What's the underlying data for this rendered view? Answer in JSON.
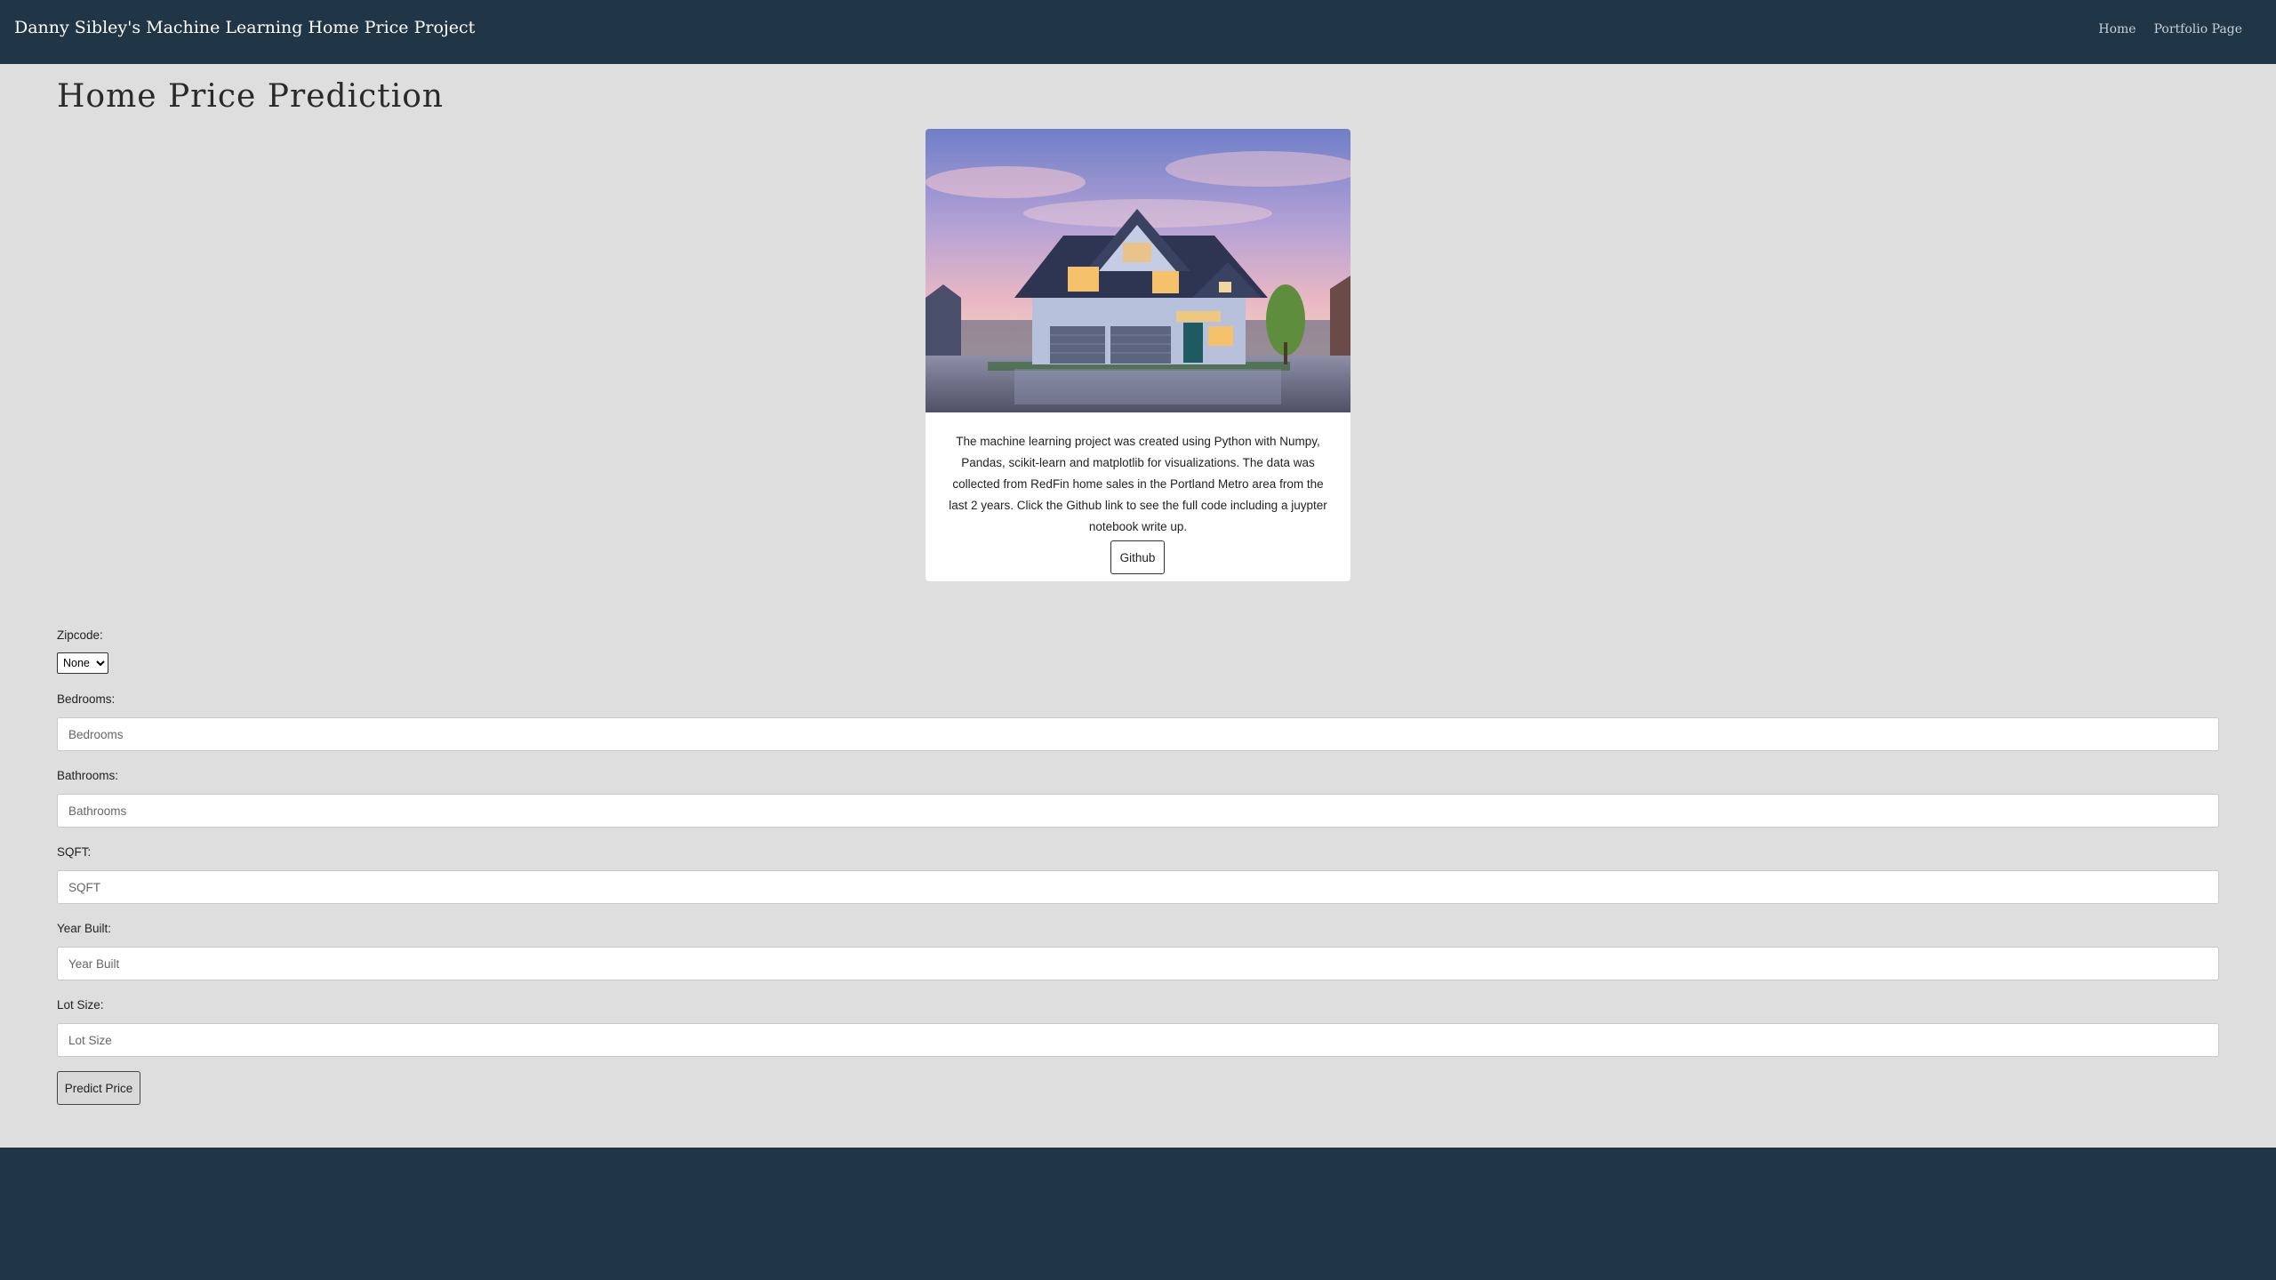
{
  "navbar": {
    "brand": "Danny Sibley's Machine Learning Home Price Project",
    "links": [
      "Home",
      "Portfolio Page"
    ]
  },
  "page": {
    "title": "Home Price Prediction"
  },
  "card": {
    "image_icon": "house-photo",
    "description": "The machine learning project was created using Python with Numpy, Pandas, scikit-learn and matplotlib for visualizations. The data was collected from RedFin home sales in the Portland Metro area from the last 2 years. Click the Github link to see the full code including a juypter notebook write up.",
    "button_label": "Github"
  },
  "form": {
    "zipcode": {
      "label": "Zipcode:",
      "selected": "None"
    },
    "bedrooms": {
      "label": "Bedrooms:",
      "placeholder": "Bedrooms",
      "value": ""
    },
    "bathrooms": {
      "label": "Bathrooms:",
      "placeholder": "Bathrooms",
      "value": ""
    },
    "sqft": {
      "label": "SQFT:",
      "placeholder": "SQFT",
      "value": ""
    },
    "year_built": {
      "label": "Year Built:",
      "placeholder": "Year Built",
      "value": ""
    },
    "lot_size": {
      "label": "Lot Size:",
      "placeholder": "Lot Size",
      "value": ""
    },
    "submit_label": "Predict Price"
  },
  "colors": {
    "navbar_bg": "#203646",
    "page_bg": "#dedede",
    "card_bg": "#ffffff"
  }
}
